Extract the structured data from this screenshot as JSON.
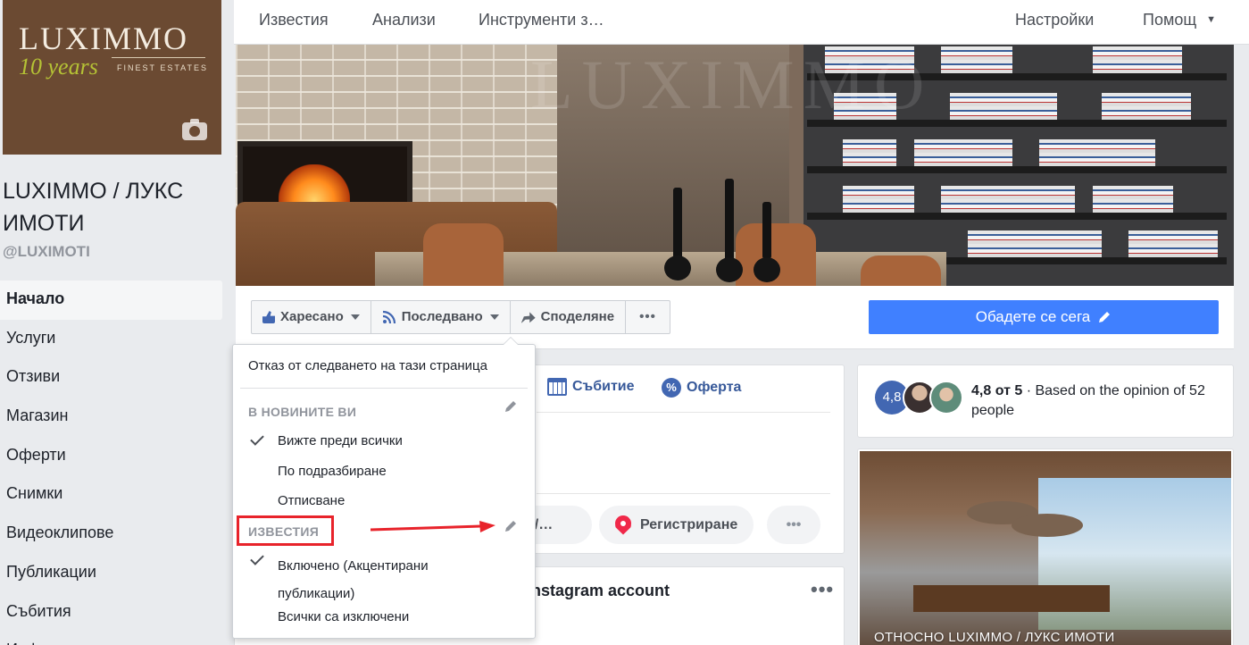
{
  "sidebar": {
    "logo": {
      "brand": "LUXIMMO",
      "years": "10 years",
      "tag": "FINEST ESTATES"
    },
    "page_name": "LUXIMMO / ЛУКС ИМОТИ",
    "handle": "@LUXIMOTI",
    "items": [
      {
        "label": "Начало",
        "active": true
      },
      {
        "label": "Услуги"
      },
      {
        "label": "Отзиви"
      },
      {
        "label": "Магазин"
      },
      {
        "label": "Оферти"
      },
      {
        "label": "Снимки"
      },
      {
        "label": "Видеоклипове"
      },
      {
        "label": "Публикации"
      },
      {
        "label": "Събития"
      },
      {
        "label": "Информация"
      }
    ]
  },
  "topbar": {
    "tabs": [
      "Известия",
      "Анализи",
      "Инструменти з…"
    ],
    "settings": "Настройки",
    "help": "Помощ"
  },
  "cover": {
    "watermark": "LUXIMMO"
  },
  "actions": {
    "like": "Харесано",
    "follow": "Последвано",
    "share": "Споделяне",
    "more": "•••",
    "cta": "Обадете се сега"
  },
  "composer": {
    "event": "Събитие",
    "offer": "Оферта",
    "pill1": "се/…",
    "checkin": "Регистриране",
    "more": "•••"
  },
  "post": {
    "title": "nstagram account",
    "more": "•••"
  },
  "rating": {
    "score": "4,8",
    "score_text": "4,8 от 5",
    "opinion": "Based on the opinion of 52 people"
  },
  "about": {
    "caption": "ОТНОСНО LUXIMMO / ЛУКС ИМОТИ"
  },
  "dropdown": {
    "unfollow": "Отказ от следването на тази страница",
    "news_header": "В НОВИНИТЕ ВИ",
    "see_first": "Вижте преди всички",
    "default": "По подразбиране",
    "unsubscribe": "Отписване",
    "notif_header": "ИЗВЕСТИЯ",
    "on_highlights_1": "Включено (Акцентирани",
    "on_highlights_2": "публикации)",
    "all_off": "Всички са изключени"
  },
  "colors": {
    "accent": "#4267b2",
    "cta": "#4080ff",
    "highlight": "#e8232b",
    "logo_bg": "#6b4a32"
  }
}
